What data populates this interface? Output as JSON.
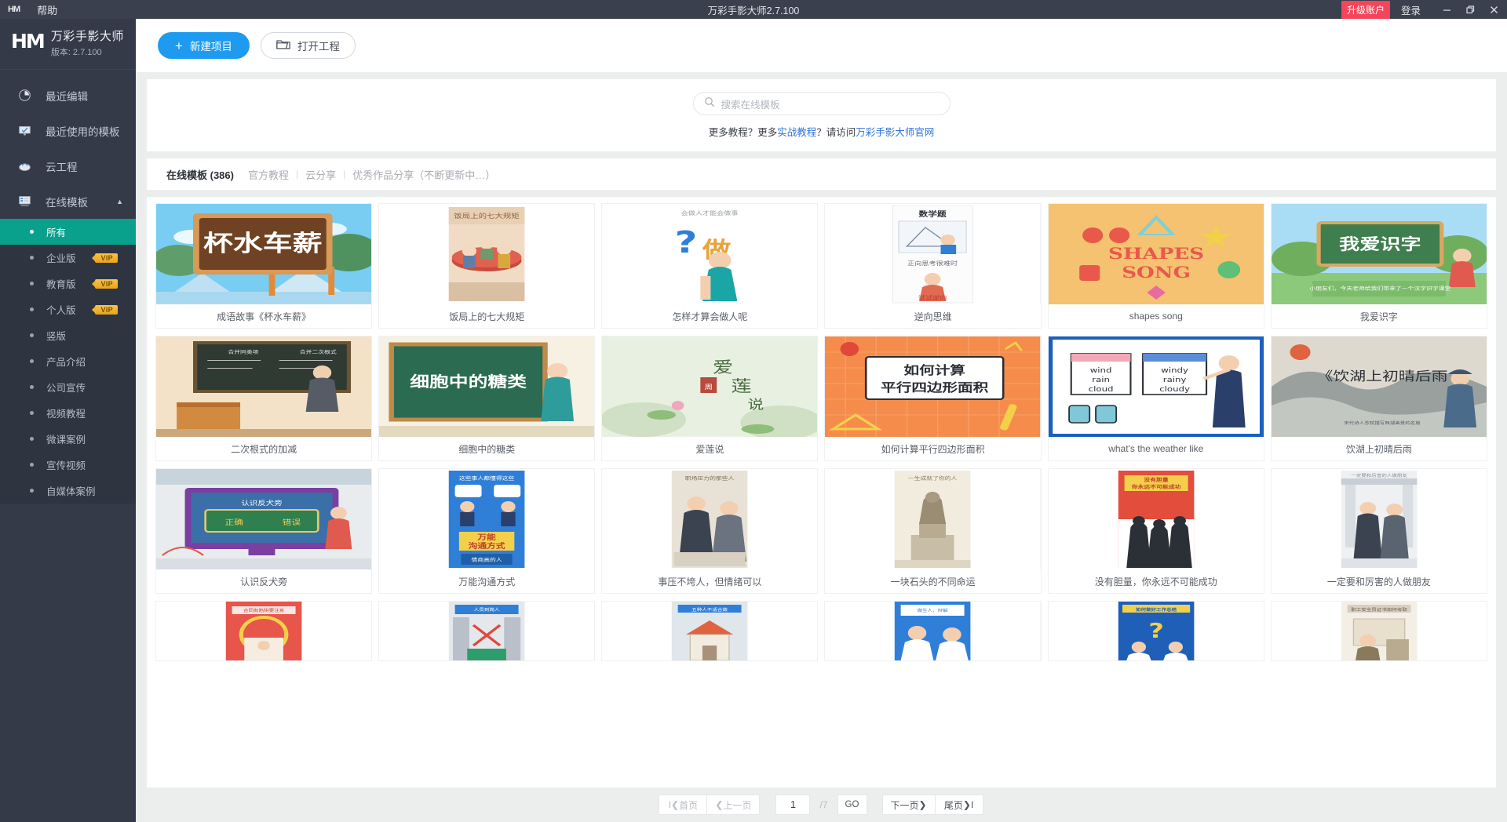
{
  "titlebar": {
    "logo": "HM",
    "menu": "帮助",
    "title": "万彩手影大师2.7.100",
    "upgrade": "升级账户",
    "login": "登录",
    "minimize_icon": "minimize-icon",
    "restore_icon": "restore-icon",
    "close_icon": "close-icon"
  },
  "sidebar": {
    "brand_mark": "HM",
    "brand_name": "万彩手影大师",
    "version": "版本: 2.7.100",
    "nav": [
      {
        "label": "最近编辑",
        "icon": "clock-icon"
      },
      {
        "label": "最近使用的模板",
        "icon": "monitor-icon"
      },
      {
        "label": "云工程",
        "icon": "cloud-icon"
      },
      {
        "label": "在线模板",
        "icon": "template-icon",
        "caret": "▲"
      }
    ],
    "sub_items": [
      {
        "label": "所有",
        "vip": "",
        "active": true
      },
      {
        "label": "企业版",
        "vip": "VIP",
        "active": false
      },
      {
        "label": "教育版",
        "vip": "VIP",
        "active": false
      },
      {
        "label": "个人版",
        "vip": "VIP",
        "active": false
      },
      {
        "label": "竖版",
        "vip": "",
        "active": false
      },
      {
        "label": "产品介绍",
        "vip": "",
        "active": false
      },
      {
        "label": "公司宣传",
        "vip": "",
        "active": false
      },
      {
        "label": "视频教程",
        "vip": "",
        "active": false
      },
      {
        "label": "微课案例",
        "vip": "",
        "active": false
      },
      {
        "label": "宣传视频",
        "vip": "",
        "active": false
      },
      {
        "label": "自媒体案例",
        "vip": "",
        "active": false
      }
    ]
  },
  "toolbar": {
    "new_project": "新建项目",
    "new_project_plus": "+",
    "open_project": "打开工程"
  },
  "search": {
    "placeholder": "搜索在线模板",
    "icon": "search-icon"
  },
  "tutorial": {
    "prefix": "更多教程？更多",
    "link1": "实战教程",
    "middle": "？请访问",
    "link2": "万彩手影大师官网"
  },
  "tabs": [
    {
      "label": "在线模板 (386)",
      "active": true
    },
    {
      "label": "官方教程",
      "active": false
    },
    {
      "label": "云分享",
      "active": false
    },
    {
      "label": "优秀作品分享（不断更新中…）",
      "active": false
    }
  ],
  "tab_separator": "|",
  "templates": [
    {
      "title": "成语故事《杯水车薪》",
      "art": "beishui"
    },
    {
      "title": "饭局上的七大规矩",
      "art": "fanju"
    },
    {
      "title": "怎样才算会做人呢",
      "art": "zuoren"
    },
    {
      "title": "逆向思维",
      "art": "nixiang"
    },
    {
      "title": "shapes song",
      "art": "shapes"
    },
    {
      "title": "我爱识字",
      "art": "shizi"
    },
    {
      "title": "二次根式的加减",
      "art": "erci"
    },
    {
      "title": "细胞中的糖类",
      "art": "xibao"
    },
    {
      "title": "爱莲说",
      "art": "ailian"
    },
    {
      "title": "如何计算平行四边形面积",
      "art": "pingxing"
    },
    {
      "title": "what's the weather like",
      "art": "weather"
    },
    {
      "title": "饮湖上初晴后雨",
      "art": "yinhu"
    },
    {
      "title": "认识反犬旁",
      "art": "fanquan"
    },
    {
      "title": "万能沟通方式",
      "art": "wanneng"
    },
    {
      "title": "事压不垮人，但情绪可以",
      "art": "shiya"
    },
    {
      "title": "一块石头的不同命运",
      "art": "shitou"
    },
    {
      "title": "没有胆量，你永远不可能成功",
      "art": "danliang"
    },
    {
      "title": "一定要和厉害的人做朋友",
      "art": "pengyou"
    },
    {
      "title": "",
      "art": "row4a"
    },
    {
      "title": "",
      "art": "row4b"
    },
    {
      "title": "",
      "art": "row4c"
    },
    {
      "title": "",
      "art": "row4d"
    },
    {
      "title": "",
      "art": "row4e"
    },
    {
      "title": "",
      "art": "row4f"
    }
  ],
  "pager": {
    "first": "首页",
    "prev": "上一页",
    "current_page": "1",
    "total_pages": "/7",
    "go": "GO",
    "next": "下一页",
    "last": "尾页",
    "first_icon": "double-left-icon",
    "prev_icon": "chevron-left-icon",
    "next_icon": "chevron-right-icon",
    "last_icon": "double-right-icon"
  },
  "colors": {
    "accent_blue": "#1e9bf0",
    "sidebar_bg": "#343a48",
    "active_green": "#09a08c",
    "upgrade_red": "#f4455a",
    "vip_gold": "#efb42c"
  }
}
